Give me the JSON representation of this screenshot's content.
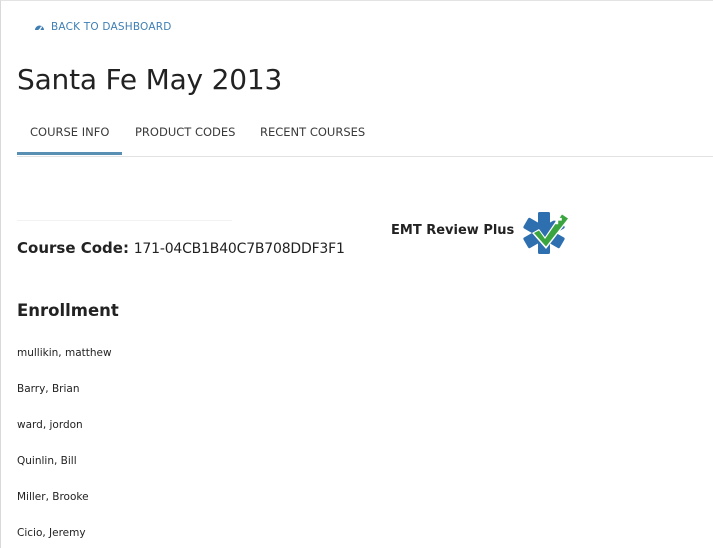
{
  "nav": {
    "back_label": "BACK TO DASHBOARD"
  },
  "page": {
    "title": "Santa Fe May 2013"
  },
  "tabs": [
    {
      "label": "COURSE INFO",
      "active": true
    },
    {
      "label": "PRODUCT CODES",
      "active": false
    },
    {
      "label": "RECENT COURSES",
      "active": false
    }
  ],
  "course": {
    "code_label": "Course Code:",
    "code_value": "171-04CB1B40C7B708DDF3F1"
  },
  "brand": {
    "name": "EMT Review Plus",
    "logo_icon": "star-of-life-checkmark-icon",
    "colors": {
      "star": "#2e6fb0",
      "check": "#3aa53f"
    }
  },
  "enrollment": {
    "heading": "Enrollment",
    "students": [
      "mullikin, matthew",
      "Barry, Brian",
      "ward, jordon",
      "Quinlin, Bill",
      "Miller, Brooke",
      "Cicio, Jeremy"
    ]
  },
  "colors": {
    "link": "#3f7fb4",
    "tab_underline": "#5a8fb4"
  }
}
